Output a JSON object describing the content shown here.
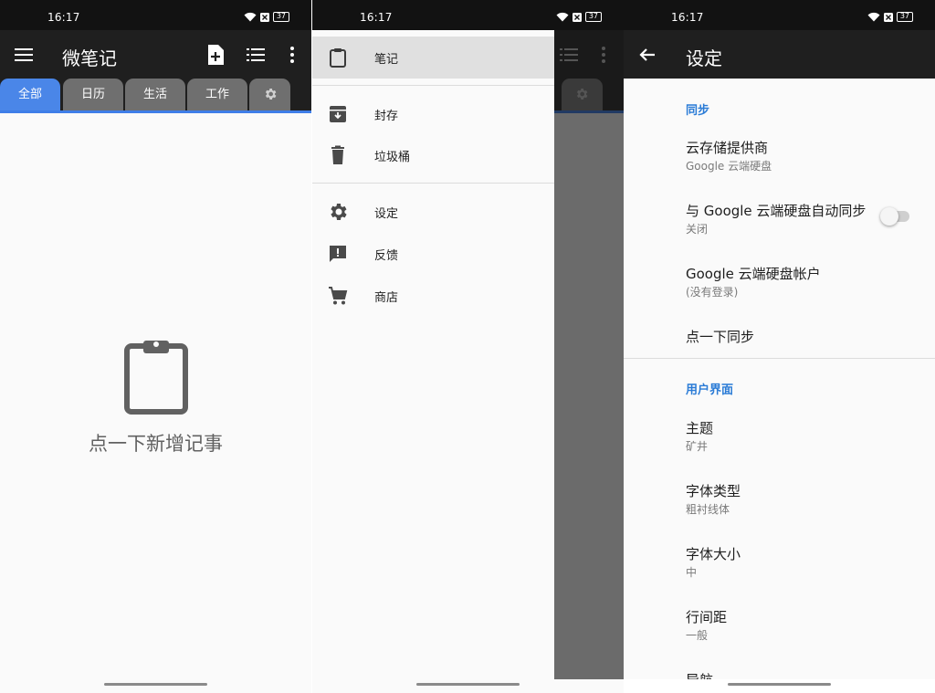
{
  "status": {
    "time": "16:17",
    "battery": "37"
  },
  "screen1": {
    "title": "微笔记",
    "tabs": [
      "全部",
      "日历",
      "生活",
      "工作"
    ],
    "empty_text": "点一下新增记事"
  },
  "screen2": {
    "items": [
      {
        "label": "笔记",
        "icon": "clipboard-icon"
      },
      {
        "label": "封存",
        "icon": "archive-icon"
      },
      {
        "label": "垃圾桶",
        "icon": "trash-icon"
      },
      {
        "label": "设定",
        "icon": "gear-icon"
      },
      {
        "label": "反馈",
        "icon": "feedback-icon"
      },
      {
        "label": "商店",
        "icon": "cart-icon"
      }
    ]
  },
  "screen3": {
    "title": "设定",
    "sections": [
      {
        "header": "同步",
        "items": [
          {
            "title": "云存储提供商",
            "subtitle": "Google 云端硬盘"
          },
          {
            "title": "与 Google 云端硬盘自动同步",
            "subtitle": "关闭"
          },
          {
            "title": "Google 云端硬盘帐户",
            "subtitle": "(没有登录)"
          },
          {
            "title": "点一下同步",
            "subtitle": ""
          }
        ]
      },
      {
        "header": "用户界面",
        "items": [
          {
            "title": "主题",
            "subtitle": "矿井"
          },
          {
            "title": "字体类型",
            "subtitle": "粗衬线体"
          },
          {
            "title": "字体大小",
            "subtitle": "中"
          },
          {
            "title": "行间距",
            "subtitle": "一般"
          },
          {
            "title": "导航",
            "subtitle": ""
          }
        ]
      }
    ]
  },
  "colors": {
    "accent": "#4a86e8",
    "header_blue": "#2a7bd6",
    "toolbar": "#1f1f1f",
    "tab_inactive": "#6f6f6f"
  }
}
